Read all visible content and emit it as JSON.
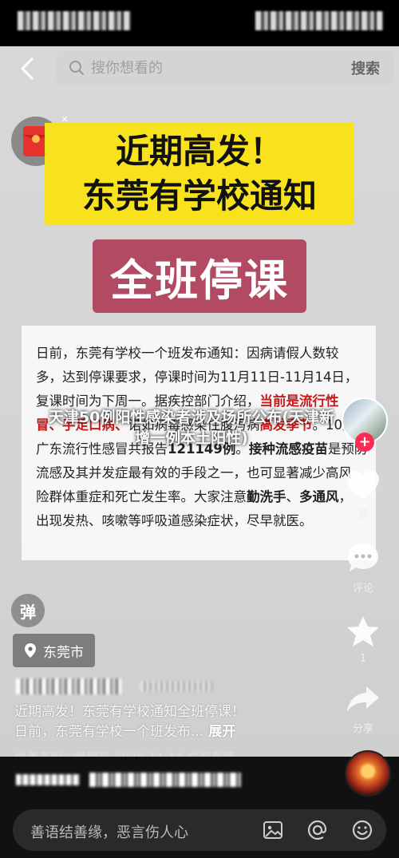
{
  "search": {
    "placeholder": "搜你想看的",
    "button": "搜索"
  },
  "video": {
    "title_line1": "近期高发！",
    "title_line2": "东莞有学校通知",
    "banner": "全班停课",
    "doc_lines": [
      [
        {
          "t": "日前，东莞有学校一个班发布通知：因病请假人数较",
          "c": ""
        }
      ],
      [
        {
          "t": "多，达到停课要求，停课时间为11月11日-11月14日，",
          "c": ""
        }
      ],
      [
        {
          "t": "复课时间为下周一。据疾控部门介绍，",
          "c": ""
        },
        {
          "t": "当前是流行性",
          "c": "red"
        }
      ],
      [
        {
          "t": "冒、手足口病、",
          "c": "red"
        },
        {
          "t": "诺如病毒",
          "c": ""
        },
        {
          "t": "感染性腹泻病",
          "c": ""
        },
        {
          "t": "高发季节",
          "c": "red"
        },
        {
          "t": "。10月",
          "c": ""
        }
      ],
      [
        {
          "t": "广东流行性感冒共报告",
          "c": ""
        },
        {
          "t": "121149例",
          "c": "b"
        },
        {
          "t": "。",
          "c": ""
        },
        {
          "t": "接种流感疫苗",
          "c": "b"
        },
        {
          "t": "是预防",
          "c": ""
        }
      ],
      [
        {
          "t": "流感及其并发症最有效的手段之一，也可显著减少高风",
          "c": ""
        }
      ],
      [
        {
          "t": "险群体重症和死亡发生率。大家注意",
          "c": ""
        },
        {
          "t": "勤洗手",
          "c": "b"
        },
        {
          "t": "、",
          "c": ""
        },
        {
          "t": "多通风",
          "c": "b"
        },
        {
          "t": "，",
          "c": ""
        }
      ],
      [
        {
          "t": "出现发热、咳嗽等呼吸道感染症状，尽早就医。",
          "c": ""
        }
      ]
    ],
    "overlay_title": "天津50例阳性感染者涉及场所公布(天津新增一例本土阳性)"
  },
  "rail": {
    "like_label": "赞",
    "comment_label": "评论",
    "favorite_count": "1",
    "share_label": "分享"
  },
  "danmu_label": "弹",
  "location": "东莞市",
  "caption": {
    "line1": "近期高发！东莞有学校通知全班停课！",
    "line2": "日前，东莞有学校一个班发布...",
    "expand": "展开"
  },
  "disclaimer": "作者声明：租稿平 2025-11-14 广东东莞",
  "comment_bar": {
    "placeholder": "善语结善缘，恶言伤人心"
  },
  "colors": {
    "accent": "#fe2c55",
    "title_yellow": "#f7e21d",
    "banner_red": "#b24a64",
    "doc_red": "#c81818"
  },
  "icons": [
    "back-icon",
    "search-icon",
    "red-packet-icon",
    "heart-icon",
    "comment-icon",
    "star-icon",
    "share-icon",
    "location-icon",
    "image-icon",
    "at-icon",
    "emoji-icon"
  ]
}
